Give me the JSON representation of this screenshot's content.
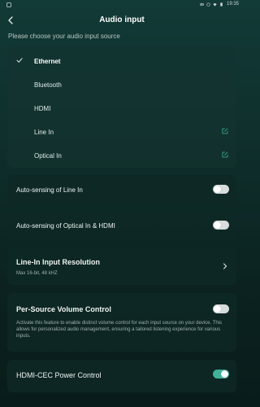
{
  "status_bar": {
    "time": "19:35",
    "icons": [
      "notification-icon",
      "eye-icon",
      "alarm-icon",
      "wifi-icon",
      "battery-icon"
    ]
  },
  "header": {
    "title": "Audio input",
    "back_icon": "chevron-left-icon"
  },
  "subtitle": "Please choose your audio input source",
  "sources": [
    {
      "label": "Ethernet",
      "selected": true,
      "editable": false
    },
    {
      "label": "Bluetooth",
      "selected": false,
      "editable": false
    },
    {
      "label": "HDMI",
      "selected": false,
      "editable": false
    },
    {
      "label": "Line In",
      "selected": false,
      "editable": true
    },
    {
      "label": "Optical In",
      "selected": false,
      "editable": true
    }
  ],
  "settings": {
    "auto_line_in": {
      "label": "Auto-sensing of Line In",
      "enabled": false
    },
    "auto_optical_hdmi": {
      "label": "Auto-sensing of Optical In & HDMI",
      "enabled": false
    },
    "line_in_resolution": {
      "label": "Line-In Input Resolution",
      "value": "Max 16-bit, 48 kHZ"
    },
    "per_source_volume": {
      "label": "Per-Source Volume Control",
      "enabled": false,
      "description": "Activate this feature to enable distinct volume control for each input source on your device. This allows for personalized audio management, ensuring a tailored listening experience for various inputs."
    },
    "hdmi_cec": {
      "label": "HDMI-CEC Power Control",
      "enabled": true
    }
  },
  "colors": {
    "accent": "#3fb39a",
    "toggle_off": "#d7dddc",
    "background_top": "#123a36",
    "background_bottom": "#091c1b"
  }
}
